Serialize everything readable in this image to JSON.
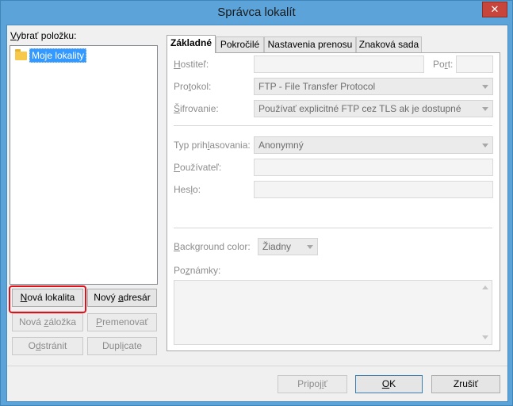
{
  "window": {
    "title": "Správca lokalít",
    "close_glyph": "✕"
  },
  "left": {
    "select_label_mn": "V",
    "select_label_rest": "ybrať položku:",
    "tree_item": "Moje lokality",
    "buttons": {
      "new_site_mn": "N",
      "new_site_rest": "ová lokalita",
      "new_folder_pre": "Nový ",
      "new_folder_mn": "a",
      "new_folder_rest": "dresár",
      "new_bookmark_pre": "Nová ",
      "new_bookmark_mn": "z",
      "new_bookmark_rest": "áložka",
      "rename_mn": "P",
      "rename_rest": "remenovať",
      "delete_pre": "O",
      "delete_mn": "d",
      "delete_rest": "stránit",
      "duplicate_pre": "Dupl",
      "duplicate_mn": "i",
      "duplicate_rest": "cate"
    }
  },
  "tabs": [
    "Základné",
    "Pokročilé",
    "Nastavenia prenosu",
    "Znaková sada"
  ],
  "general": {
    "host_label_mn": "H",
    "host_label_rest": "ostiteľ:",
    "port_label_pre": "Po",
    "port_label_mn": "r",
    "port_label_rest": "t:",
    "protocol_label_pre": "Pro",
    "protocol_label_mn": "t",
    "protocol_label_rest": "okol:",
    "protocol_value": "FTP - File Transfer Protocol",
    "encryption_label_mn": "Š",
    "encryption_label_rest": "ifrovanie:",
    "encryption_value": "Používať explicitné FTP cez TLS ak je dostupné",
    "logon_label_pre": "Typ prih",
    "logon_label_mn": "l",
    "logon_label_rest": "asovania:",
    "logon_value": "Anonymný",
    "user_label_mn": "P",
    "user_label_rest": "oužívateľ:",
    "password_label_pre": "Hes",
    "password_label_mn": "l",
    "password_label_rest": "o:",
    "bg_label_pre": "",
    "bg_label_mn": "B",
    "bg_label_rest": "ackground color:",
    "bg_value": "Žiadny",
    "notes_label_pre": "Po",
    "notes_label_mn": "z",
    "notes_label_rest": "námky:"
  },
  "footer": {
    "connect_pre": "Pripoj",
    "connect_mn": "i",
    "connect_rest": "ť",
    "ok_mn": "O",
    "ok_rest": "K",
    "cancel": "Zrušiť"
  }
}
